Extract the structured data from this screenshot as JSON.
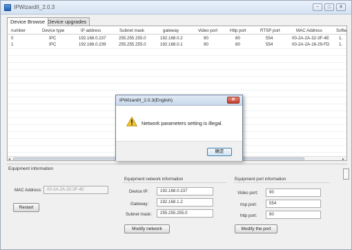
{
  "window": {
    "title": "IPWizardII_2.0.3",
    "buttons": {
      "minimize": "−",
      "maximize": "□",
      "close": "✕"
    }
  },
  "tabs": [
    {
      "label": "Device Browse",
      "active": true
    },
    {
      "label": "Device upgrades",
      "active": false
    }
  ],
  "grid": {
    "columns": [
      "number",
      "Device type",
      "IP address",
      "Subnet mask",
      "gateway",
      "Video port",
      "Http port",
      "RTSP port",
      "MAC Address",
      "Softw"
    ],
    "rows": [
      [
        "0",
        "IPC",
        "192.168.0.237",
        "255.255.255.0",
        "192.168.0.2",
        "90",
        "80",
        "554",
        "00-2A-2A-32-3F-4E",
        "1."
      ],
      [
        "1",
        "IPC",
        "192.168.0.239",
        "255.255.255.0",
        "192.168.0.1",
        "90",
        "80",
        "554",
        "00-2A-2A-16-29-FD",
        "1."
      ]
    ],
    "scroll_left": "◂",
    "scroll_right": "▸"
  },
  "equipment": {
    "section_title": "Equipment information",
    "mac_label": "MAC Address:",
    "mac_value": "00-2A-2A-32-3F-4E",
    "restart_label": "Restart"
  },
  "network": {
    "title": "Equipment network information",
    "ip_label": "Device IP:",
    "ip_value": "192.168.0.237",
    "gateway_label": "Gateway:",
    "gateway_value": "192.168.1.2",
    "mask_label": "Subnet mask:",
    "mask_value": "255.255.255.0",
    "modify_label": "Modify network"
  },
  "ports": {
    "title": "Equipment port information",
    "video_label": "Video port:",
    "video_value": "90",
    "rtsp_label": "rtsp port:",
    "rtsp_value": "554",
    "http_label": "http port:",
    "http_value": "80",
    "modify_label": "Modify the port"
  },
  "dialog": {
    "title": "IPWizardII_2.0.3(English)",
    "message": "Network parameters setting is illegal.",
    "ok_label": "确定",
    "close_glyph": "✕",
    "icon": "warning-icon"
  },
  "colors": {
    "warning": "#f2c230",
    "close_button": "#c63b25"
  }
}
